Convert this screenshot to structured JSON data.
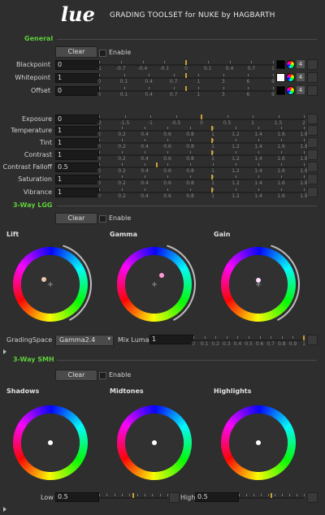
{
  "header": {
    "logo": "lue",
    "title": "GRADING TOOLSET for NUKE by HAGBARTH"
  },
  "general": {
    "section_label": "General",
    "clear_label": "Clear",
    "enable_label": "Enable",
    "rows": [
      {
        "label": "Blackpoint",
        "value": "0",
        "swatch": "#000000"
      },
      {
        "label": "Whitepoint",
        "value": "1",
        "swatch": "#ffffff"
      },
      {
        "label": "Offset",
        "value": "0",
        "swatch": "#000000"
      }
    ],
    "channels_count": "4",
    "ticks_a": [
      "-1",
      "-0.7",
      "-0.4",
      "-0.1",
      "0",
      "0.1",
      "0.4",
      "0.7",
      "1"
    ],
    "ticks_b": [
      "0",
      "0.1",
      "0.4",
      "0.7",
      "1",
      "3",
      "6",
      "9"
    ],
    "adjust": [
      {
        "label": "Exposure",
        "value": "0"
      },
      {
        "label": "Temperature",
        "value": "1"
      },
      {
        "label": "Tint",
        "value": "1"
      },
      {
        "label": "Contrast",
        "value": "1"
      },
      {
        "label": "Contrast Falloff",
        "value": "0.5"
      },
      {
        "label": "Saturation",
        "value": "1"
      },
      {
        "label": "Vibrance",
        "value": "1"
      }
    ],
    "ticks_exposure": [
      "-2",
      "-1.5",
      "-1",
      "-0.5",
      "0",
      "0.5",
      "1",
      "1.5",
      "2"
    ],
    "ticks_adj": [
      "0",
      "0.2",
      "0.4",
      "0.6",
      "0.8",
      "1",
      "1.2",
      "1.4",
      "1.6",
      "1.8"
    ]
  },
  "lgg": {
    "section_label": "3-Way LGG",
    "clear_label": "Clear",
    "enable_label": "Enable",
    "wheels": [
      {
        "label": "Lift"
      },
      {
        "label": "Gamma"
      },
      {
        "label": "Gain"
      }
    ],
    "grading_space_label": "GradingSpace",
    "grading_space_value": "Gamma2.4",
    "mix_luma_label": "Mix Luma",
    "mix_luma_value": "1",
    "ticks_mix": [
      "0",
      "0.1",
      "0.2",
      "0.3",
      "0.4",
      "0.5",
      "0.6",
      "0.7",
      "0.8",
      "0.9",
      "1"
    ]
  },
  "smh": {
    "section_label": "3-Way SMH",
    "clear_label": "Clear",
    "enable_label": "Enable",
    "wheels": [
      {
        "label": "Shadows"
      },
      {
        "label": "Midtones"
      },
      {
        "label": "Highlights"
      }
    ],
    "low_label": "Low",
    "low_value": "0.5",
    "high_label": "High",
    "high_value": "0.5"
  }
}
